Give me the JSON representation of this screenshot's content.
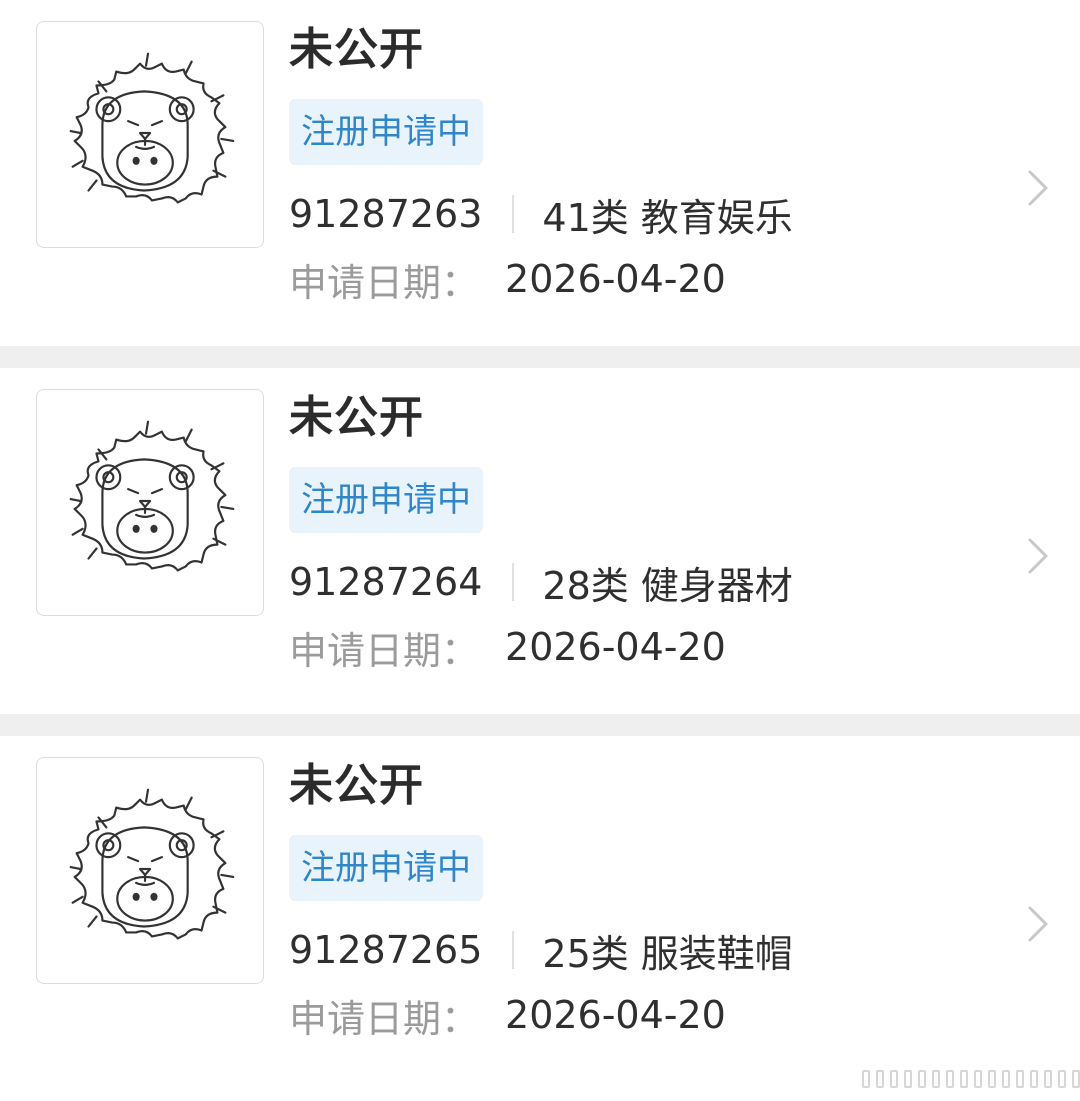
{
  "trademarks": [
    {
      "name": "未公开",
      "status": "注册申请中",
      "reg_number": "91287263",
      "class_number": "41类",
      "class_name": "教育娱乐",
      "date_label": "申请日期：",
      "date": "2026-04-20"
    },
    {
      "name": "未公开",
      "status": "注册申请中",
      "reg_number": "91287264",
      "class_number": "28类",
      "class_name": "健身器材",
      "date_label": "申请日期：",
      "date": "2026-04-20"
    },
    {
      "name": "未公开",
      "status": "注册申请中",
      "reg_number": "91287265",
      "class_number": "25类",
      "class_name": "服装鞋帽",
      "date_label": "申请日期：",
      "date": "2026-04-20"
    }
  ],
  "icons": {
    "thumbnail": "lion-mascot-logo",
    "row_action": "chevron-right-icon"
  },
  "colors": {
    "status_text": "#2f86c9",
    "status_bg": "#e9f3fb",
    "separator": "#efefef",
    "label_gray": "#9b9b9b"
  }
}
